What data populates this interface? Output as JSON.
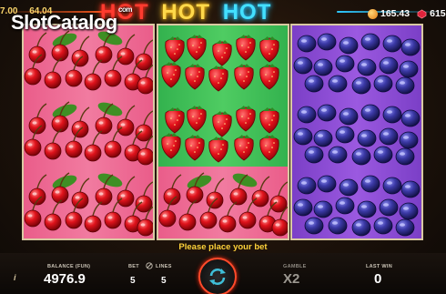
{
  "topbar": {
    "left_value_1": "7.00",
    "left_value_2": "64.04",
    "coins": "165.43",
    "gems": "615"
  },
  "watermark": {
    "text": "SlotCatalog",
    "sub": "com"
  },
  "logo": {
    "word1": "HOT",
    "word2": "HOT",
    "word3": "HOT"
  },
  "reels": [
    {
      "symbol": "cherries",
      "icon": "cherry-icon",
      "color": "#ea5d8a"
    },
    {
      "symbol": "strawberries",
      "icon": "strawberry-icon",
      "color": "#33b24e"
    },
    {
      "symbol": "plums",
      "icon": "plum-icon",
      "color": "#7b3fc7"
    }
  ],
  "message": "Please place your bet",
  "footer": {
    "info_icon": "i",
    "balance_label": "BALANCE (FUN)",
    "balance_value": "4976.9",
    "bet_label": "BET",
    "bet_value": "5",
    "lines_label": "LINES",
    "lines_value": "5",
    "gamble_label": "GAMBLE",
    "gamble_value": "X2",
    "last_win_label": "LAST WIN",
    "last_win_value": "0"
  },
  "colors": {
    "accent": "#ffd23a",
    "spin_ring": "#ff4a2a"
  }
}
